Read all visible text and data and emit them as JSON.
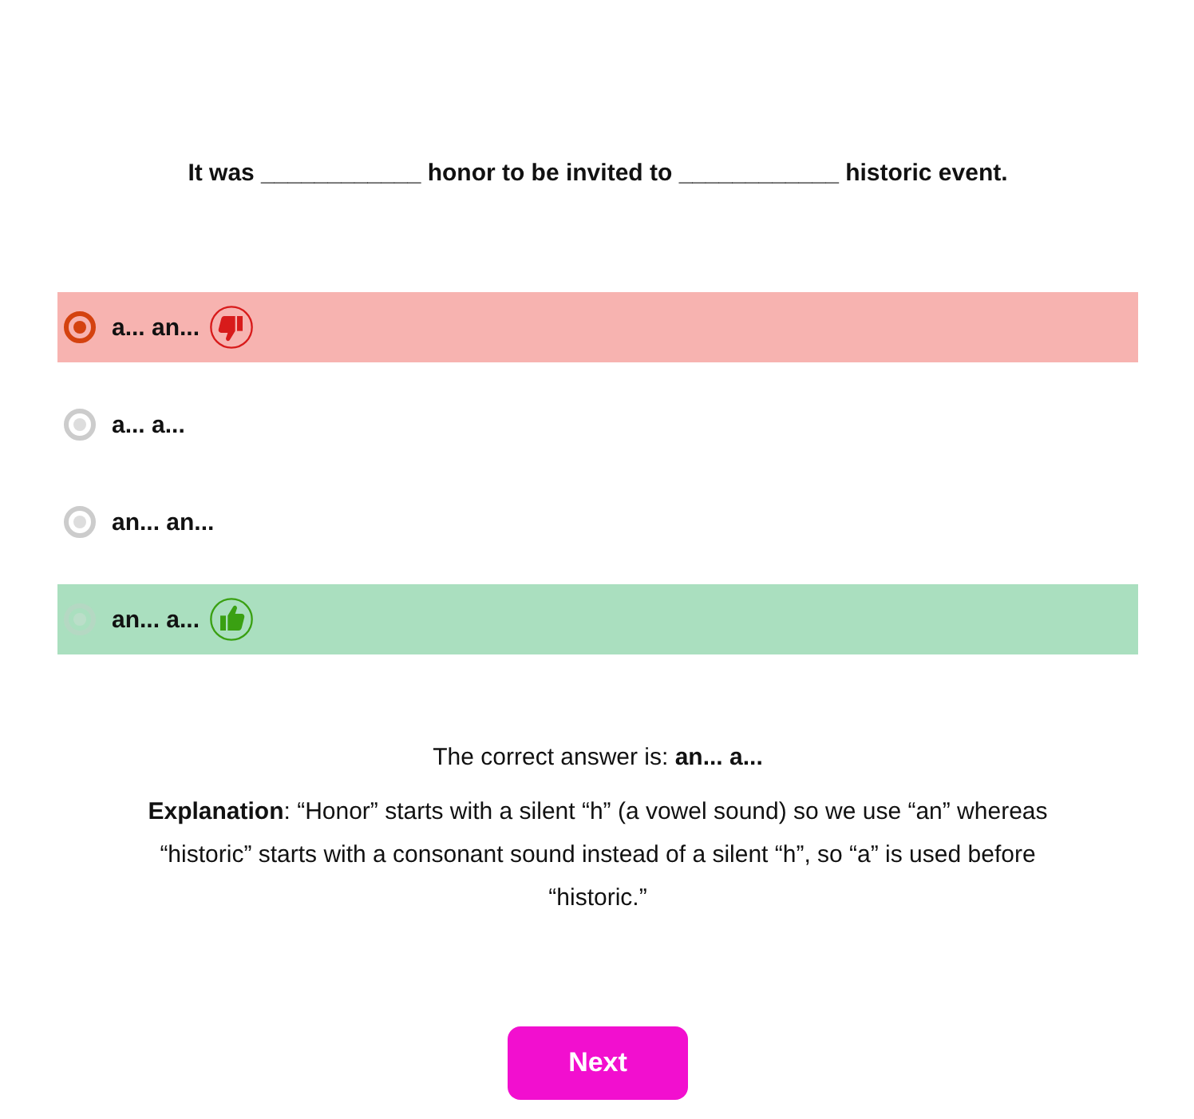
{
  "question": "It was ____________ honor to be invited to ____________ historic event.",
  "options": [
    {
      "label": "a... an...",
      "selected": true,
      "kind": "wrong"
    },
    {
      "label": "a... a...",
      "selected": false,
      "kind": "plain"
    },
    {
      "label": "an... an...",
      "selected": false,
      "kind": "plain"
    },
    {
      "label": "an... a...",
      "selected": false,
      "kind": "correct"
    }
  ],
  "answer": "The correct answer is: **an... a...**",
  "explanation": "**Explanation**: “Honor” starts with a silent “h” (a vowel sound) so we use “an” whereas “historic” starts with a consonant sound instead of a silent “h”, so “a” is used before “historic.”",
  "button": "Next"
}
